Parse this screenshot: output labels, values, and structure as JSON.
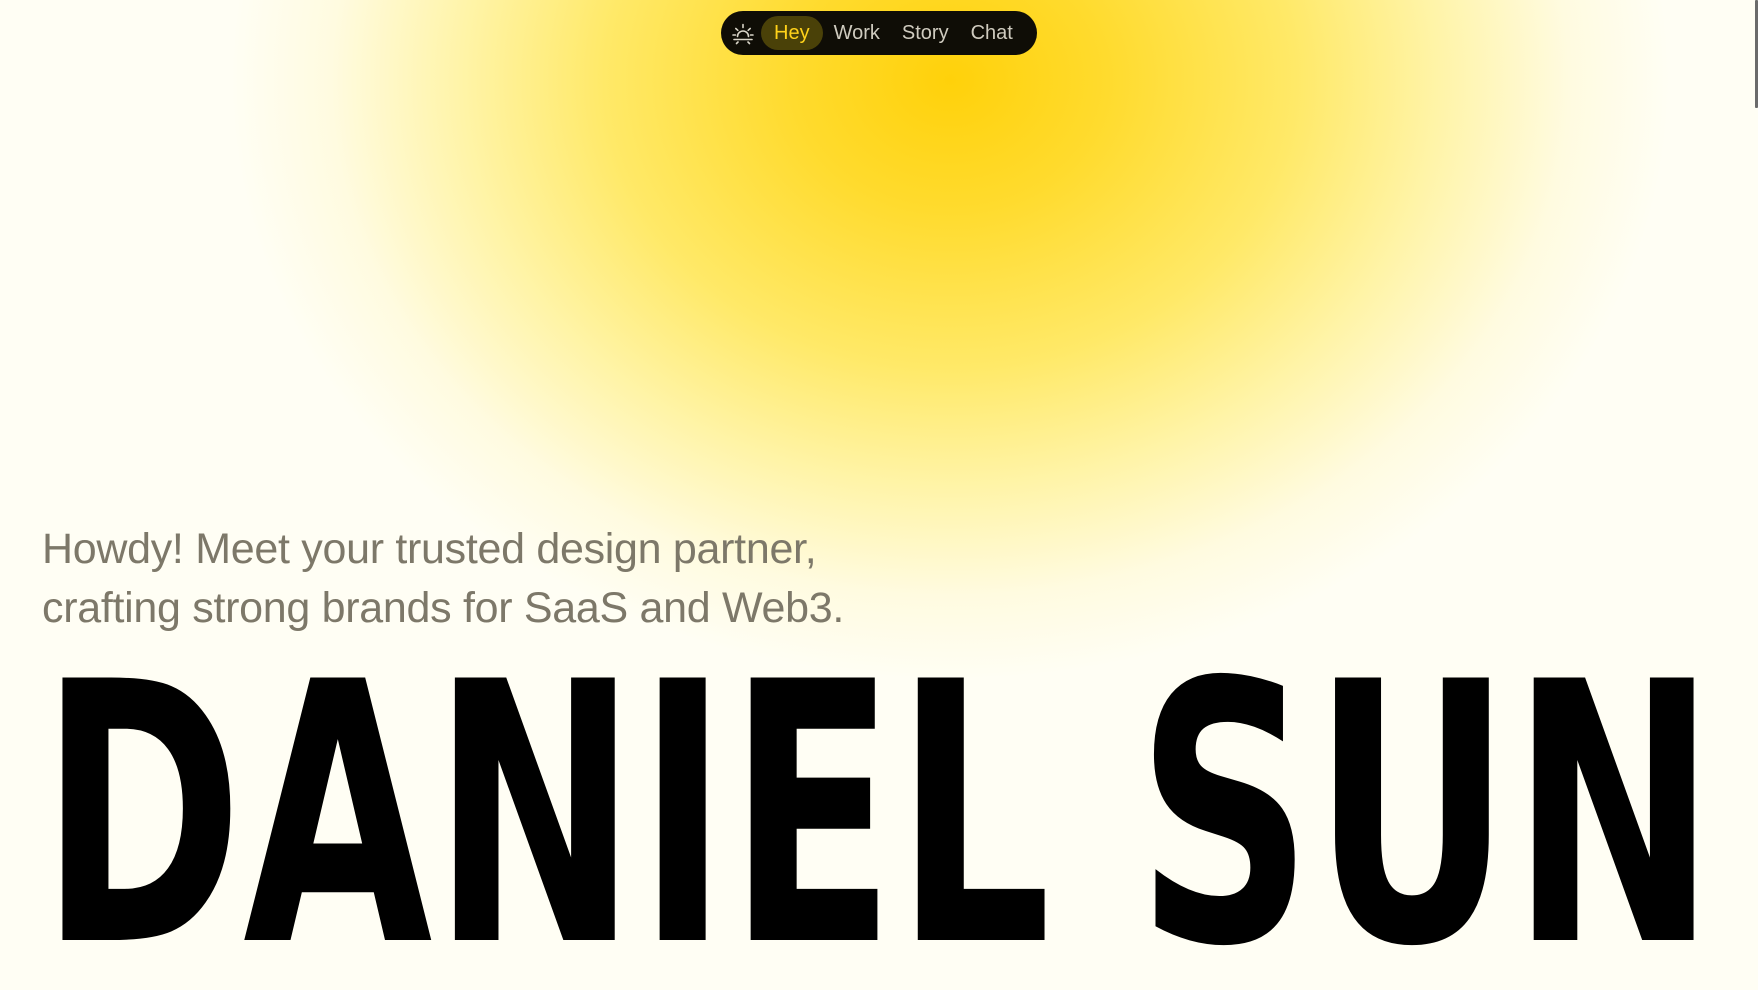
{
  "nav": {
    "theme_icon": "sun-icon",
    "items": [
      {
        "label": "Hey",
        "active": true
      },
      {
        "label": "Work",
        "active": false
      },
      {
        "label": "Story",
        "active": false
      },
      {
        "label": "Chat",
        "active": false
      }
    ]
  },
  "hero": {
    "tagline_line1": "Howdy! Meet your trusted design partner,",
    "tagline_line2": "crafting strong brands for SaaS and Web3.",
    "name": "DANIEL SUN"
  },
  "colors": {
    "accent": "#ffd10a",
    "nav_bg": "#0f0d06",
    "tagline": "#7d7869",
    "name": "#000000"
  }
}
